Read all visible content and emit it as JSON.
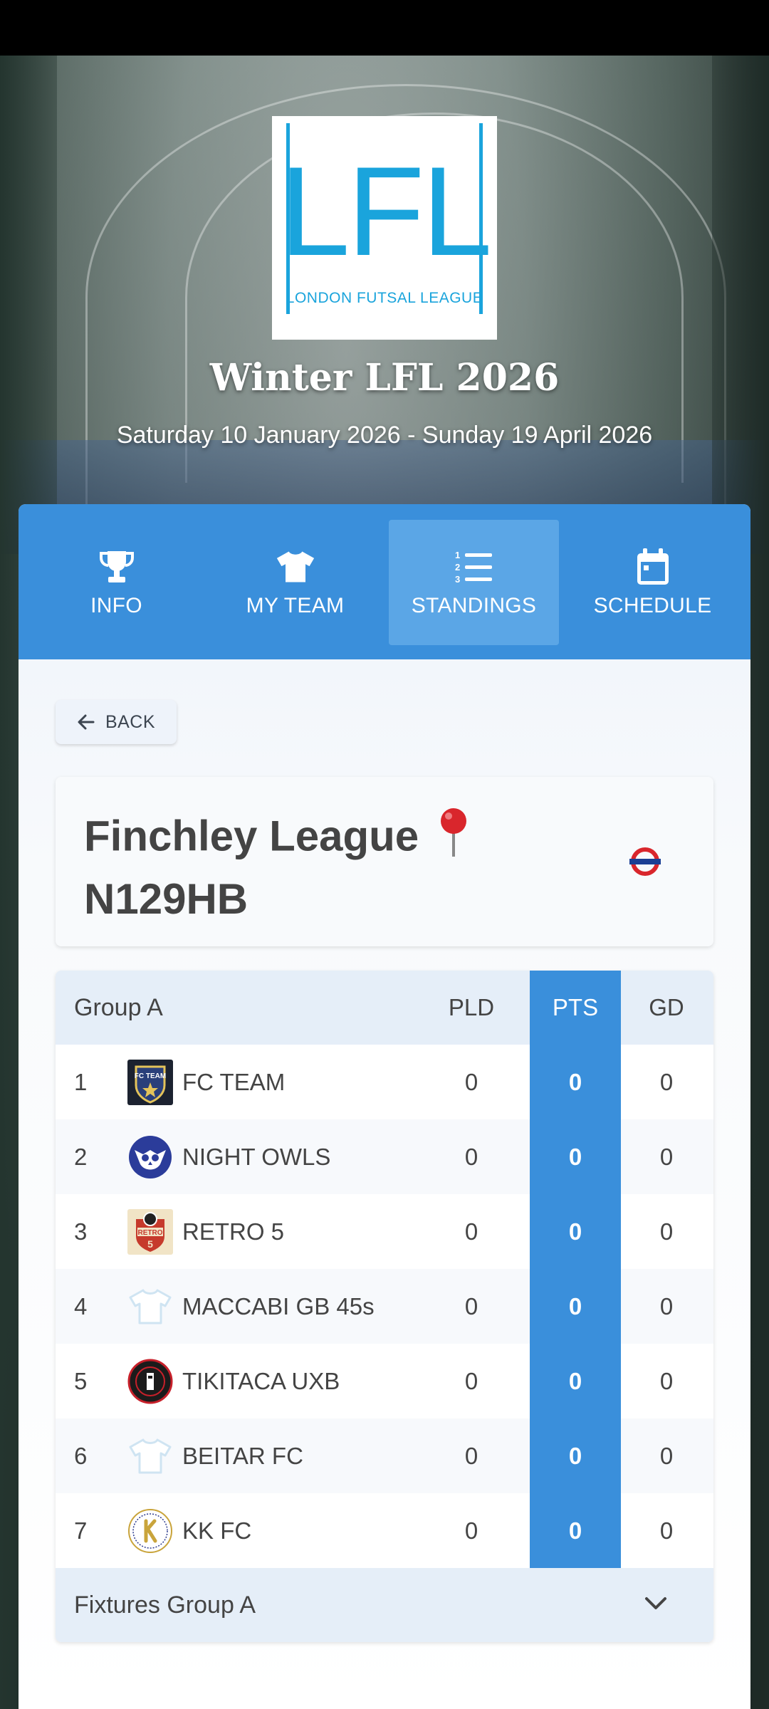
{
  "hero": {
    "logo_letters": "LFL",
    "logo_subtitle": "LONDON FUTSAL LEAGUE",
    "title": "Winter LFL 2026",
    "dates": "Saturday 10 January 2026 - Sunday 19 April 2026"
  },
  "tabs": [
    {
      "label": "INFO",
      "icon": "trophy-icon"
    },
    {
      "label": "MY TEAM",
      "icon": "shirt-icon"
    },
    {
      "label": "STANDINGS",
      "icon": "list-ordered-icon",
      "active": true
    },
    {
      "label": "SCHEDULE",
      "icon": "calendar-icon"
    }
  ],
  "back_label": "BACK",
  "venue": {
    "name": "Finchley League",
    "postcode": "N129HB",
    "pin_icon": "map-pin-icon",
    "station_icon": "underground-roundel-icon"
  },
  "standings": {
    "group_label": "Group A",
    "columns": {
      "pld": "PLD",
      "pts": "PTS",
      "gd": "GD"
    },
    "rows": [
      {
        "pos": "1",
        "team": "FC TEAM",
        "pld": "0",
        "pts": "0",
        "gd": "0",
        "badge": "fc-team-badge"
      },
      {
        "pos": "2",
        "team": "NIGHT OWLS",
        "pld": "0",
        "pts": "0",
        "gd": "0",
        "badge": "owl-badge"
      },
      {
        "pos": "3",
        "team": "RETRO 5",
        "pld": "0",
        "pts": "0",
        "gd": "0",
        "badge": "retro-5-badge"
      },
      {
        "pos": "4",
        "team": "MACCABI GB 45s",
        "pld": "0",
        "pts": "0",
        "gd": "0",
        "badge": "default-shirt-icon"
      },
      {
        "pos": "5",
        "team": "TIKITACA UXB",
        "pld": "0",
        "pts": "0",
        "gd": "0",
        "badge": "tikitaca-badge"
      },
      {
        "pos": "6",
        "team": "BEITAR FC",
        "pld": "0",
        "pts": "0",
        "gd": "0",
        "badge": "default-shirt-icon"
      },
      {
        "pos": "7",
        "team": "KK FC",
        "pld": "0",
        "pts": "0",
        "gd": "0",
        "badge": "kk-fc-badge"
      }
    ],
    "fixtures_label": "Fixtures Group A"
  },
  "colors": {
    "primary": "#3a8fdb",
    "tab_active": "#5ba6e6",
    "logo_blue": "#1aa4dc",
    "header_bg": "#e5eef8"
  }
}
